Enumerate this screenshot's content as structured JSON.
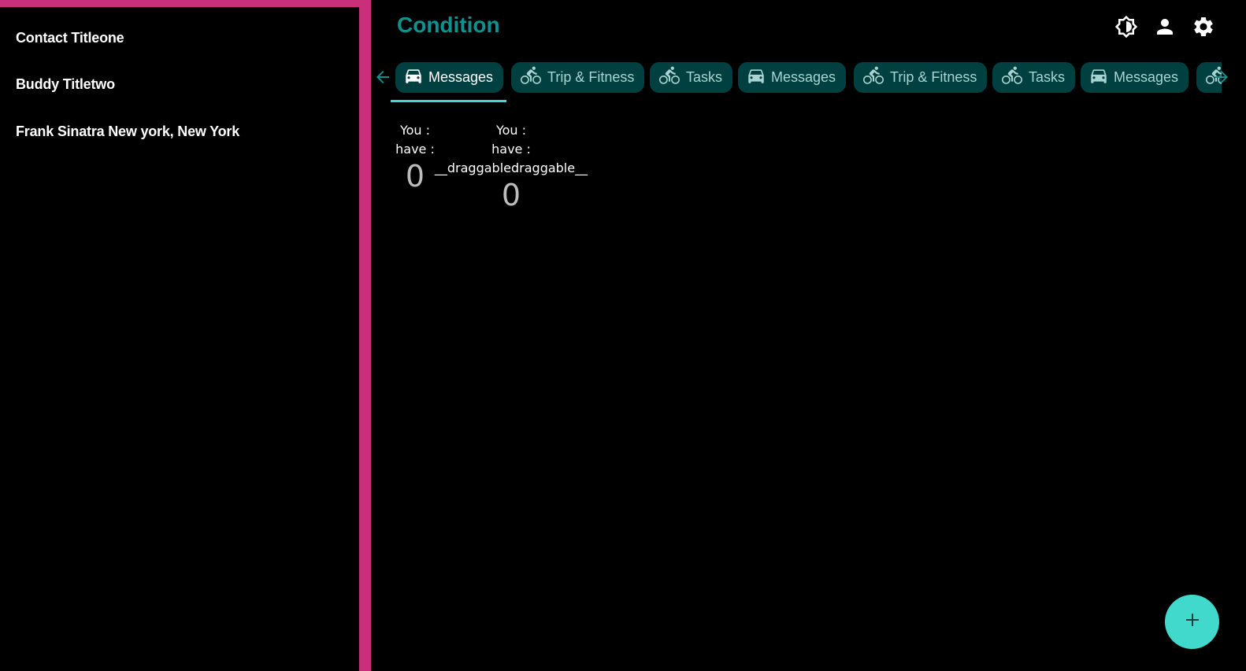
{
  "sidebar": {
    "contacts": [
      {
        "label": "Contact Titleone"
      },
      {
        "label": "Buddy Titletwo"
      },
      {
        "label": "Frank Sinatra New york, New York"
      }
    ]
  },
  "header": {
    "title": "Condition",
    "icons": [
      "brightness-icon",
      "account-icon",
      "settings-icon"
    ]
  },
  "tabs": {
    "items": [
      {
        "label": "Messages",
        "icon": "car-icon",
        "active": true
      },
      {
        "label": "Trip & Fitness",
        "icon": "bicycle-icon"
      },
      {
        "label": "Tasks",
        "icon": "bicycle-icon"
      },
      {
        "label": "Messages",
        "icon": "car-icon"
      },
      {
        "label": "Trip & Fitness",
        "icon": "bicycle-icon"
      },
      {
        "label": "Tasks",
        "icon": "bicycle-icon"
      },
      {
        "label": "Messages",
        "icon": "car-icon"
      },
      {
        "label": "",
        "icon": "bicycle-icon"
      }
    ]
  },
  "counters": [
    {
      "line1": "You :",
      "line2": "have :",
      "value": "0"
    },
    {
      "line1": "You :",
      "line2": "have :",
      "drag_text": "__draggabledraggable__",
      "value": "0"
    }
  ],
  "fab": {
    "symbol": "+"
  },
  "colors": {
    "accent": "#40d9cc",
    "title": "#0f9191",
    "tab_bg": "#014040",
    "sidebar_border": "#c9307a",
    "background": "#000000"
  }
}
